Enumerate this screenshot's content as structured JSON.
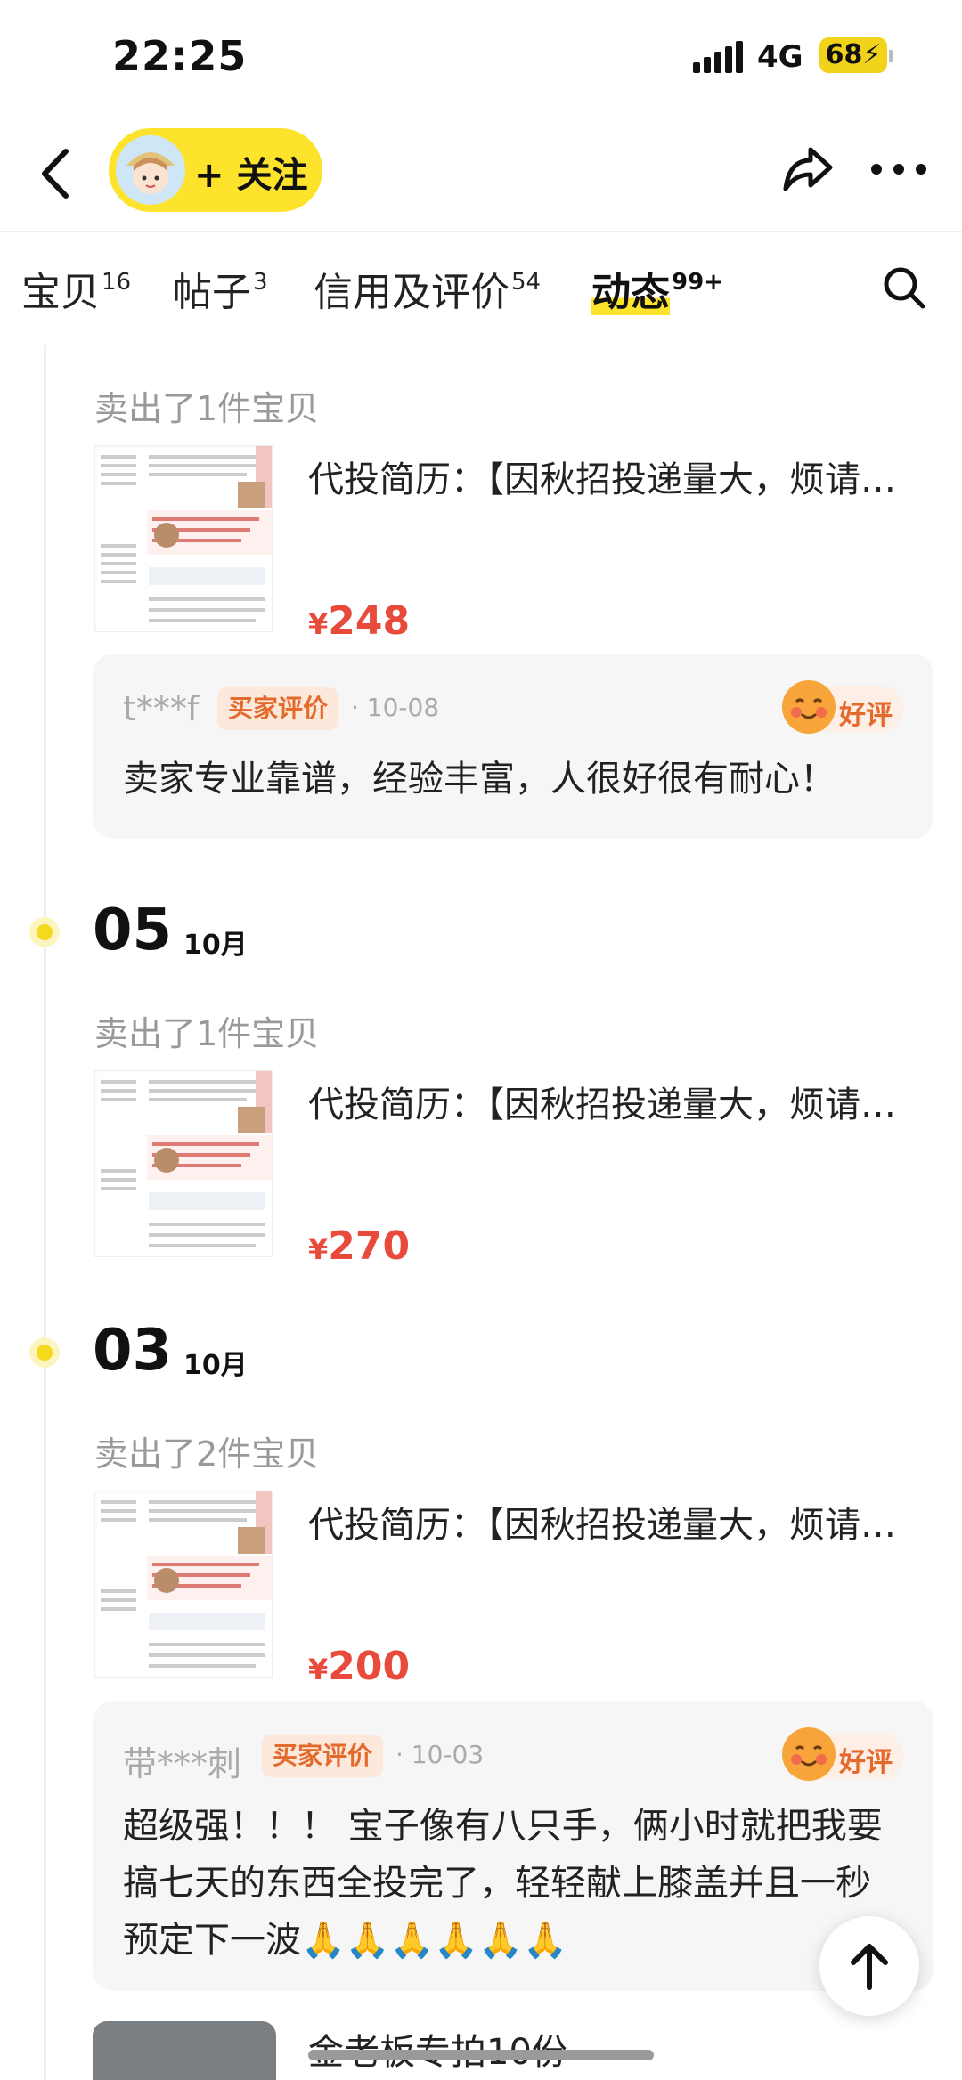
{
  "status": {
    "time": "22:25",
    "network": "4G",
    "battery": "68"
  },
  "header": {
    "follow_label": "+ 关注"
  },
  "tabs": [
    {
      "label": "宝贝",
      "count": "16"
    },
    {
      "label": "帖子",
      "count": "3"
    },
    {
      "label": "信用及评价",
      "count": "54"
    },
    {
      "label": "动态",
      "count": "99+"
    }
  ],
  "feed": {
    "entry0": {
      "sold": "卖出了1件宝贝",
      "title": "代投简历：【因秋招投递量大，烦请…",
      "currency": "¥",
      "price": "248",
      "review": {
        "reviewer": "t***f",
        "badge": "买家评价",
        "date": "· 10-08",
        "rating": "好评",
        "text": "卖家专业靠谱，经验丰富，人很好很有耐心！"
      }
    },
    "date1": {
      "day": "05",
      "month": "10月"
    },
    "entry1": {
      "sold": "卖出了1件宝贝",
      "title": "代投简历：【因秋招投递量大，烦请…",
      "currency": "¥",
      "price": "270"
    },
    "date2": {
      "day": "03",
      "month": "10月"
    },
    "entry2": {
      "sold": "卖出了2件宝贝",
      "title": "代投简历：【因秋招投递量大，烦请…",
      "currency": "¥",
      "price": "200",
      "review": {
        "reviewer": "带***刺",
        "badge": "买家评价",
        "date": "· 10-03",
        "rating": "好评",
        "line1": "超级强！！！ 宝子像有八只手，俩小时就把我要",
        "line2": "搞七天的东西全投完了，轻轻献上膝盖并且一秒",
        "line3": "预定下一波🙏🙏🙏🙏🙏🙏"
      }
    },
    "entry3": {
      "title": "金老板专拍10份"
    }
  }
}
